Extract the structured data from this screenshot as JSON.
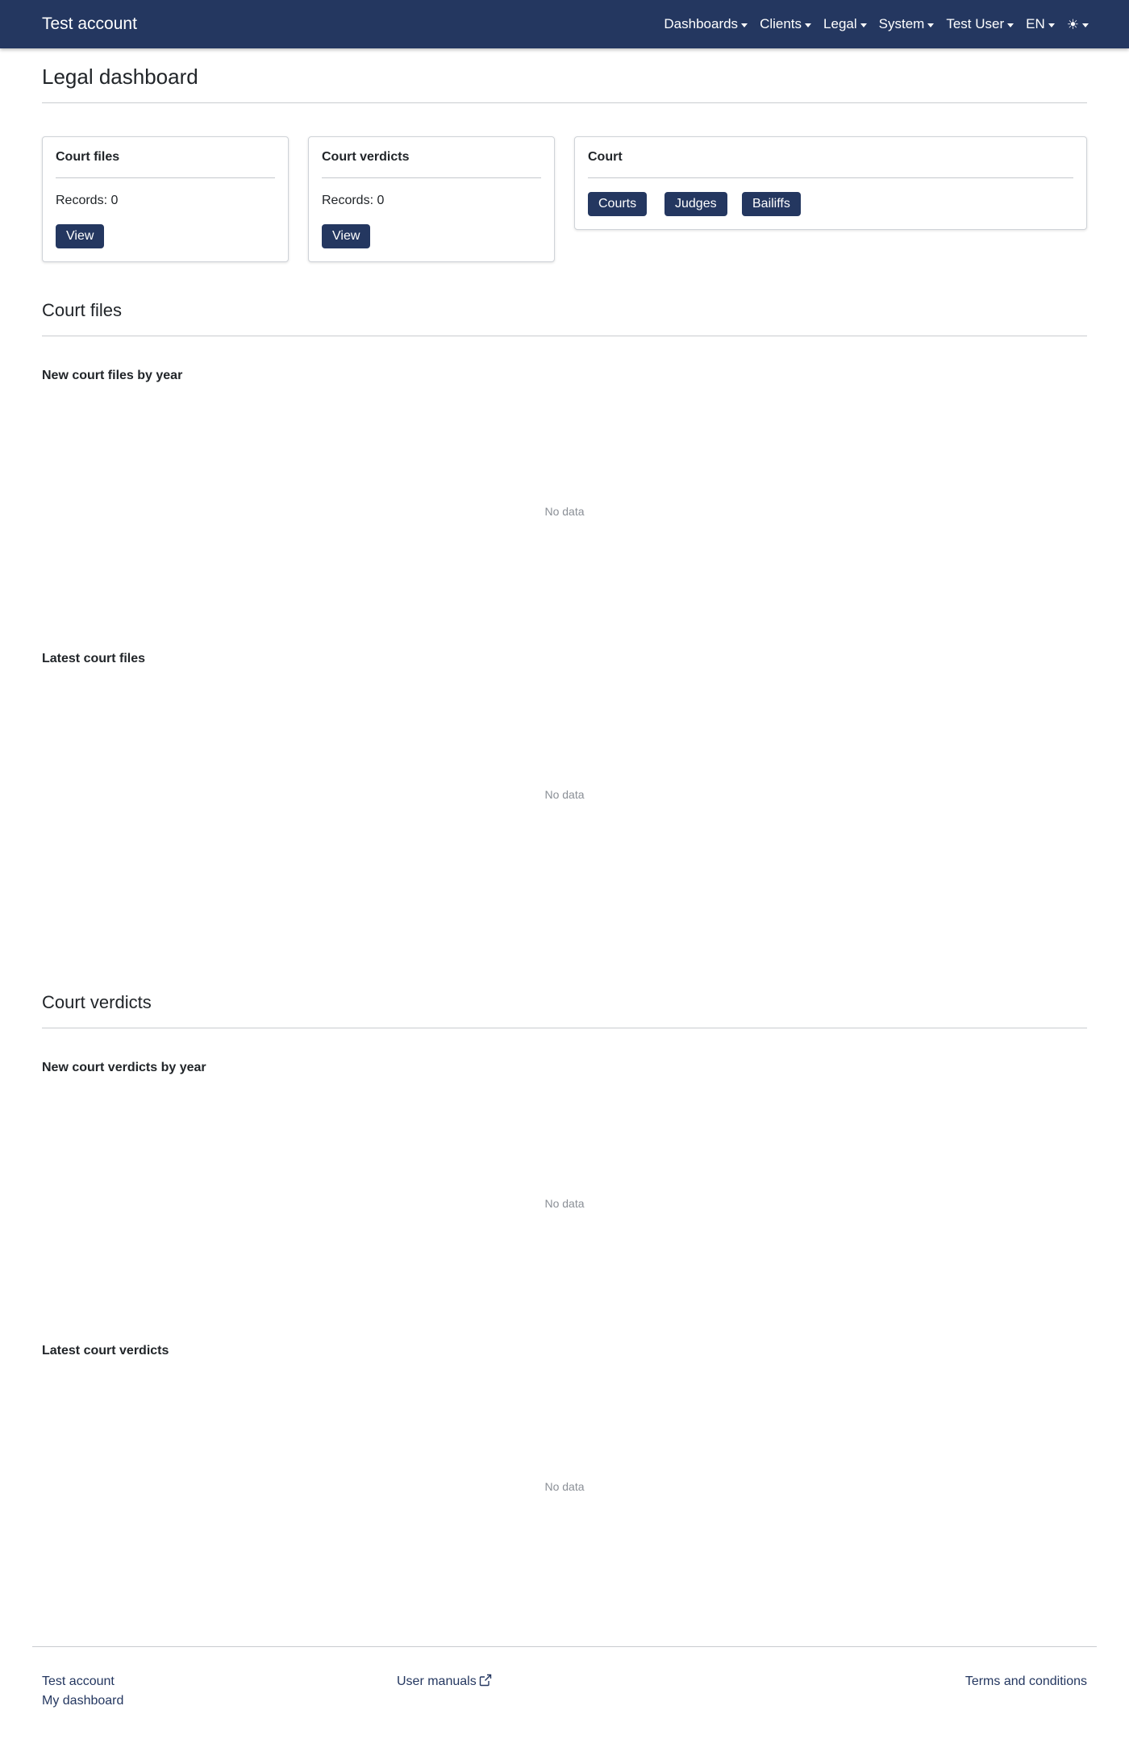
{
  "navbar": {
    "brand": "Test account",
    "items": [
      {
        "label": "Dashboards"
      },
      {
        "label": "Clients"
      },
      {
        "label": "Legal"
      },
      {
        "label": "System"
      },
      {
        "label": "Test User"
      },
      {
        "label": "EN"
      }
    ],
    "theme_icon": "☀"
  },
  "page": {
    "title": "Legal dashboard"
  },
  "cards": {
    "court_files": {
      "title": "Court files",
      "records": "Records: 0",
      "button": "View"
    },
    "court_verdicts": {
      "title": "Court verdicts",
      "records": "Records: 0",
      "button": "View"
    },
    "court": {
      "title": "Court",
      "buttons": [
        "Courts",
        "Judges",
        "Bailiffs"
      ]
    }
  },
  "sections": {
    "court_files": {
      "title": "Court files",
      "chart1": {
        "title": "New court files by year",
        "empty": "No data"
      },
      "chart2": {
        "title": "Latest court files",
        "empty": "No data"
      }
    },
    "court_verdicts": {
      "title": "Court verdicts",
      "chart1": {
        "title": "New court verdicts by year",
        "empty": "No data"
      },
      "chart2": {
        "title": "Latest court verdicts",
        "empty": "No data"
      }
    }
  },
  "footer": {
    "account": "Test account",
    "dashboard": "My dashboard",
    "manuals": "User manuals",
    "terms": "Terms and conditions"
  },
  "colors": {
    "navbar": "#243760",
    "button": "#243760",
    "link": "#243760"
  }
}
